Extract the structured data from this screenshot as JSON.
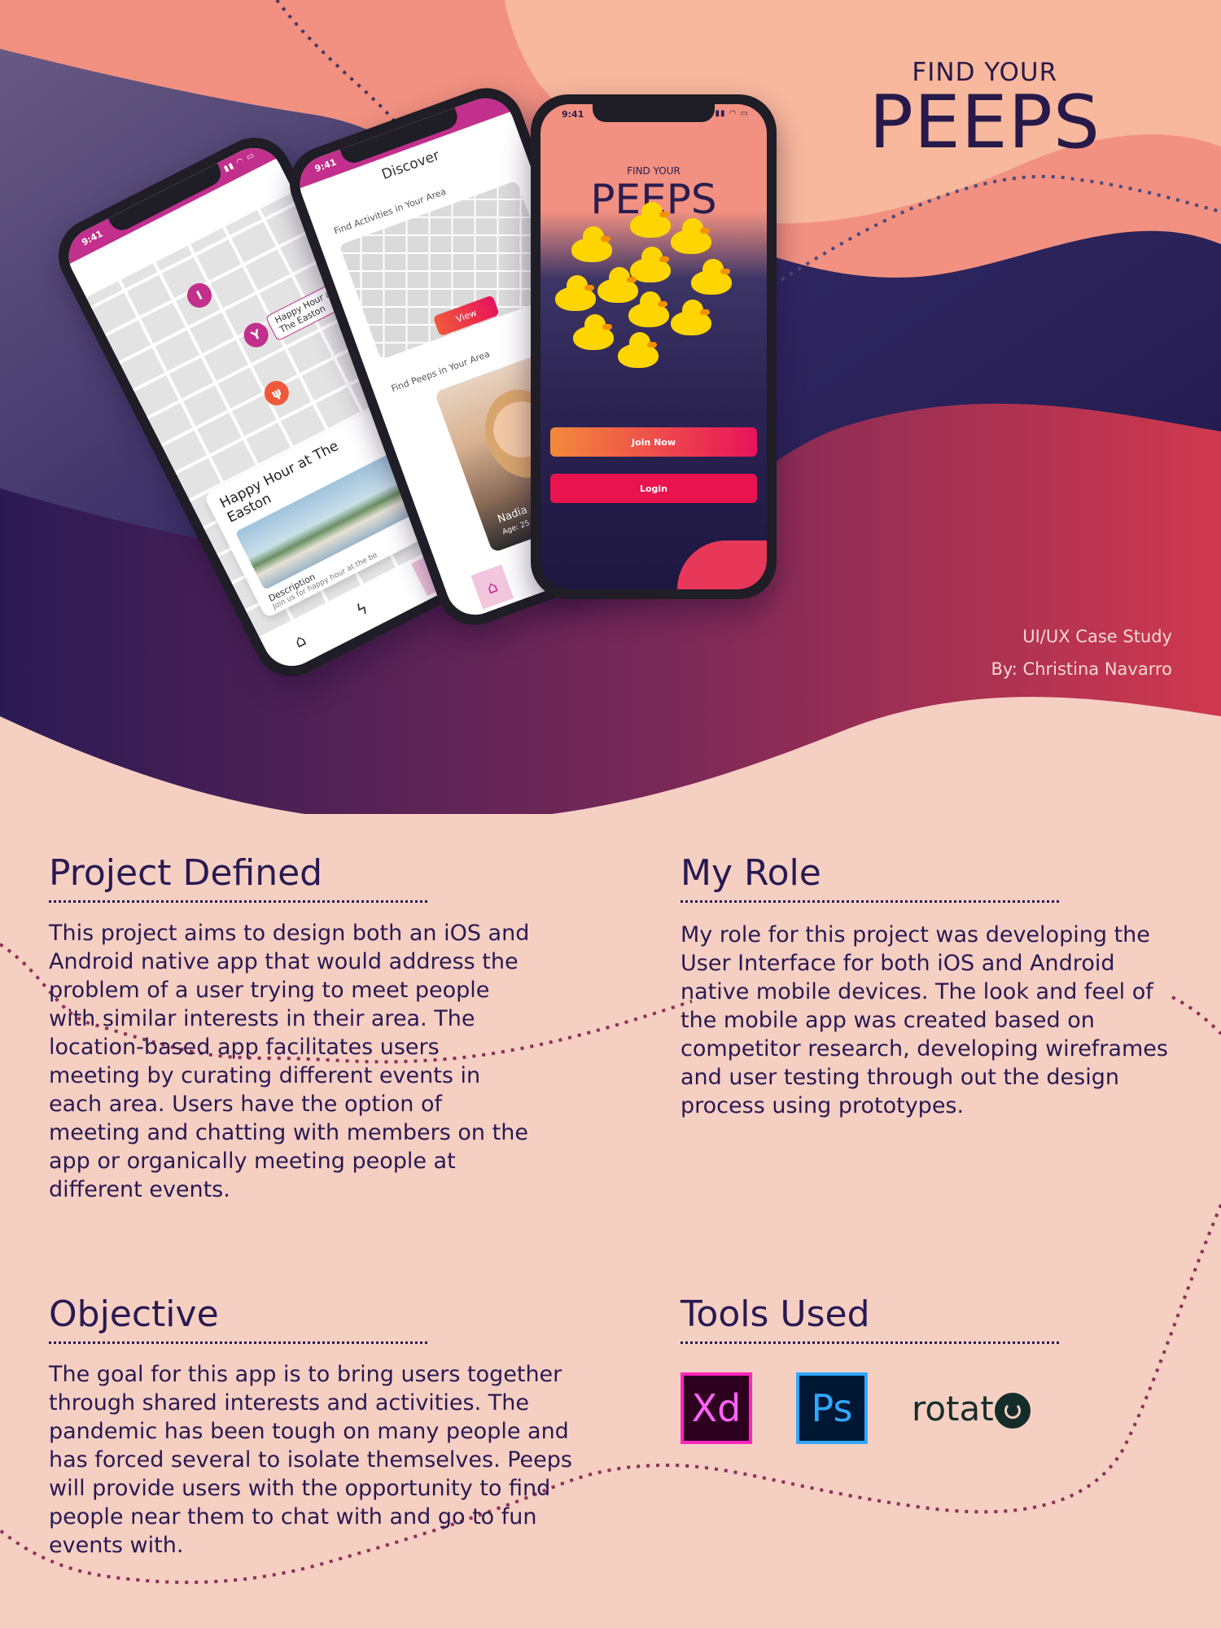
{
  "brand": {
    "small": "FIND YOUR",
    "big": "PEEPS"
  },
  "credit": {
    "line1": "UI/UX Case Study",
    "line2": "By: Christina Navarro"
  },
  "colors": {
    "navy": "#281a52",
    "salmon": "#f29181",
    "pink": "#c22f8c",
    "coral": "#e8135b",
    "background": "#f6cfc3"
  },
  "phones": {
    "map": {
      "time": "9:41",
      "tag": "Happy Hour at The Easton",
      "event_title": "Happy Hour at The Easton",
      "event_desc": "Description",
      "event_sub": "Join us for happy hour at the be"
    },
    "discover": {
      "time": "9:41",
      "title": "Discover",
      "label_activities": "Find Activities in Your Area",
      "view_button": "View",
      "label_peeps": "Find Peeps in Your Area",
      "peep_name": "Nadia",
      "peep_age": "Age: 25"
    },
    "login": {
      "time": "9:41",
      "small": "FIND YOUR",
      "big": "PEEPS",
      "join_button": "Join Now",
      "login_button": "Login"
    }
  },
  "sections": {
    "project": {
      "title": "Project Defined",
      "body": "This project aims to design both an iOS and Android  native app that would address the problem of a user trying to meet people with similar interests in their area. The location-based app facilitates users meeting by curating different events in each area. Users have the option of meeting and chatting with members on the app or organically meeting people at different events."
    },
    "role": {
      "title": "My Role",
      "body": "My role for this project was developing the User Interface for both iOS and Android native mobile devices. The look and feel of the mobile app was created based on competitor research, developing wireframes and user testing through out the design process using prototypes."
    },
    "objective": {
      "title": "Objective",
      "body": "The goal for this app is to bring users together through shared interests and activities. The pandemic has been tough on many people and has forced several to isolate themselves. Peeps will provide users with the opportunity to find people near them to chat with and go to fun events with."
    },
    "tools": {
      "title": "Tools Used",
      "items": [
        {
          "label": "Xd",
          "icon": "adobe-xd-icon"
        },
        {
          "label": "Ps",
          "icon": "photoshop-icon"
        },
        {
          "label": "rotat",
          "icon": "rotato-logo"
        }
      ]
    }
  }
}
